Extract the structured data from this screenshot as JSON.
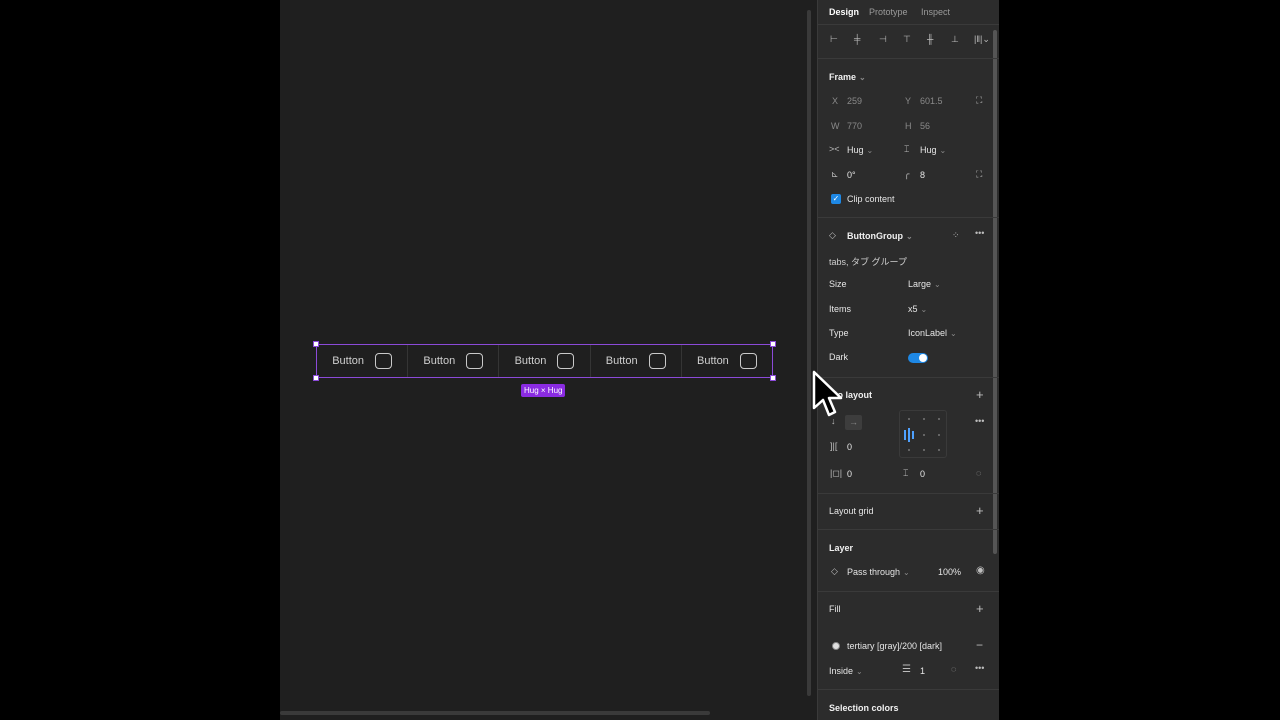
{
  "canvas": {
    "button_labels": [
      "Button",
      "Button",
      "Button",
      "Button",
      "Button"
    ],
    "size_tag": "Hug × Hug",
    "selection_color": "#8b4ad8"
  },
  "panel": {
    "tabs": [
      "Design",
      "Prototype",
      "Inspect"
    ],
    "frame": {
      "title": "Frame",
      "x_label": "X",
      "x_value": "259",
      "y_label": "Y",
      "y_value": "601.5",
      "w_label": "W",
      "w_value": "770",
      "h_label": "H",
      "h_value": "56",
      "hug_w": "Hug",
      "hug_h": "Hug",
      "rotation": "0°",
      "radius": "8",
      "clip_label": "Clip content"
    },
    "component": {
      "name": "ButtonGroup",
      "description": "tabs, タブ グループ",
      "props": [
        {
          "label": "Size",
          "value": "Large"
        },
        {
          "label": "Items",
          "value": "x5"
        },
        {
          "label": "Type",
          "value": "IconLabel"
        },
        {
          "label": "Dark",
          "value": ""
        }
      ]
    },
    "auto_layout": {
      "title": "uto layout",
      "spacing": "0",
      "padding_h": "0",
      "padding_v": "0"
    },
    "layout_grid": "Layout grid",
    "layer": {
      "title": "Layer",
      "blend": "Pass through",
      "opacity": "100%"
    },
    "fill": {
      "title": "Fill",
      "style": "tertiary [gray]/200 [dark]",
      "stroke_position": "Inside",
      "stroke_weight": "1"
    },
    "selection_colors": "Selection colors"
  },
  "colors": {
    "canvas_bg": "#1f1f1f",
    "panel_bg": "#2c2c2c",
    "accent": "#8a2be2",
    "toggle": "#1e88e5"
  }
}
